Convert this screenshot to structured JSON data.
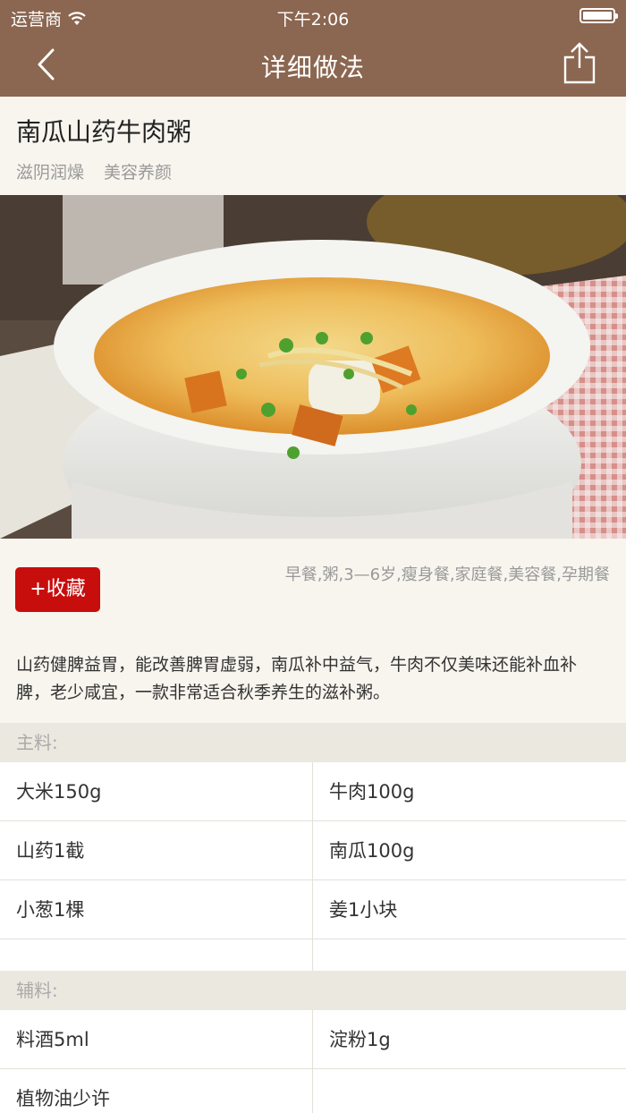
{
  "status": {
    "carrier": "运营商",
    "time": "下午2:06"
  },
  "nav": {
    "title": "详细做法"
  },
  "recipe": {
    "name": "南瓜山药牛肉粥",
    "tags": [
      "滋阴润燥",
      "美容养颜"
    ],
    "favorite_label": "+收藏",
    "categories": "早餐,粥,3—6岁,瘦身餐,家庭餐,美容餐,孕期餐",
    "description": "山药健脾益胃，能改善脾胃虚弱，南瓜补中益气，牛肉不仅美味还能补血补脾，老少咸宜，一款非常适合秋季养生的滋补粥。"
  },
  "main_ingredients": {
    "label": "主料:",
    "items": [
      "大米150g",
      "牛肉100g",
      "山药1截",
      "南瓜100g",
      "小葱1棵",
      "姜1小块"
    ]
  },
  "aux_ingredients": {
    "label": "辅料:",
    "items": [
      "料酒5ml",
      "淀粉1g",
      "植物油少许"
    ]
  },
  "colors": {
    "nav": "#8b6650",
    "accent": "#c80d0d",
    "background": "#f7f5ee"
  }
}
